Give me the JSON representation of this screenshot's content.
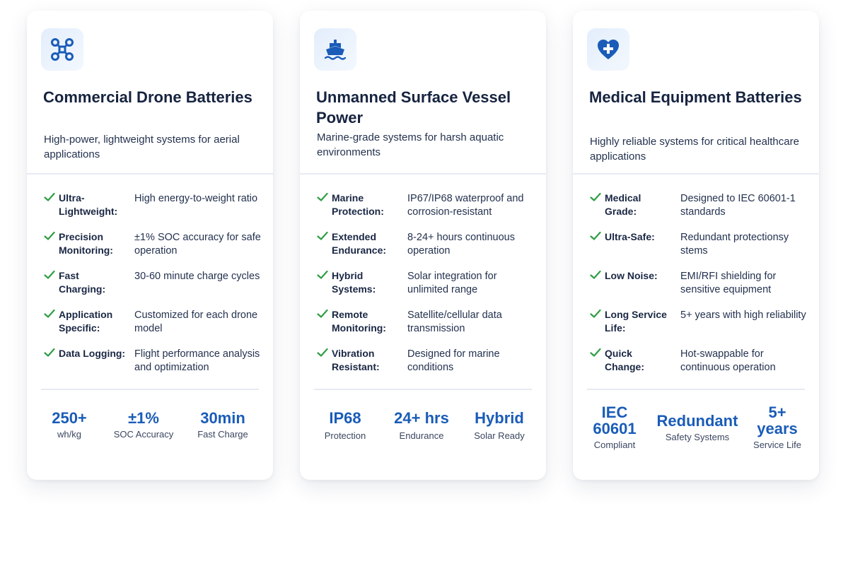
{
  "colors": {
    "accent": "#1a5cb8",
    "check": "#2f9e44",
    "title": "#16233f"
  },
  "cards": [
    {
      "icon": "drone-icon",
      "title": "Commercial Drone Batteries",
      "desc": "High-power, lightweight systems for aerial applications",
      "features": [
        {
          "label": "Ultra-Lightweight:",
          "value": "High energy-to-weight ratio"
        },
        {
          "label": "Precision Monitoring:",
          "value": "±1% SOC accuracy for safe operation"
        },
        {
          "label": "Fast Charging:",
          "value": "30-60 minute charge cycles"
        },
        {
          "label": "Application Specific:",
          "value": "Customized for each drone model"
        },
        {
          "label": "Data Logging:",
          "value": "Flight performance analysis and optimization"
        }
      ],
      "stats": [
        {
          "value": "250+",
          "label": "wh/kg"
        },
        {
          "value": "±1%",
          "label": "SOC Accuracy"
        },
        {
          "value": "30min",
          "label": "Fast Charge"
        }
      ]
    },
    {
      "icon": "ship-icon",
      "title": "Unmanned Surface Vessel Power",
      "desc": "Marine-grade systems for harsh aquatic environments",
      "features": [
        {
          "label": "Marine Protection:",
          "value": "IP67/IP68 waterproof and corrosion-resistant"
        },
        {
          "label": "Extended Endurance:",
          "value": "8-24+ hours continuous operation"
        },
        {
          "label": "Hybrid Systems:",
          "value": "Solar integration for unlimited range"
        },
        {
          "label": "Remote Monitoring:",
          "value": "Satellite/cellular data transmission"
        },
        {
          "label": "Vibration Resistant:",
          "value": "Designed for marine conditions"
        }
      ],
      "stats": [
        {
          "value": "IP68",
          "label": "Protection"
        },
        {
          "value": "24+ hrs",
          "label": "Endurance"
        },
        {
          "value": "Hybrid",
          "label": "Solar Ready"
        }
      ]
    },
    {
      "icon": "heart-plus-icon",
      "title": "Medical Equipment Batteries",
      "desc": "Highly reliable systems for critical healthcare applications",
      "features": [
        {
          "label": "Medical Grade:",
          "value": "Designed to IEC 60601-1 standards"
        },
        {
          "label": "Ultra-Safe:",
          "value": "Redundant protectionsy stems"
        },
        {
          "label": "Low Noise:",
          "value": "EMI/RFI shielding for sensitive equipment"
        },
        {
          "label": "Long Service Life:",
          "value": "5+ years with high reliability"
        },
        {
          "label": "Quick Change:",
          "value": "Hot-swappable for continuous operation"
        }
      ],
      "stats": [
        {
          "value": "IEC 60601",
          "label": "Compliant"
        },
        {
          "value": "Redundant",
          "label": "Safety Systems"
        },
        {
          "value": "5+ years",
          "label": "Service Life"
        }
      ]
    }
  ]
}
